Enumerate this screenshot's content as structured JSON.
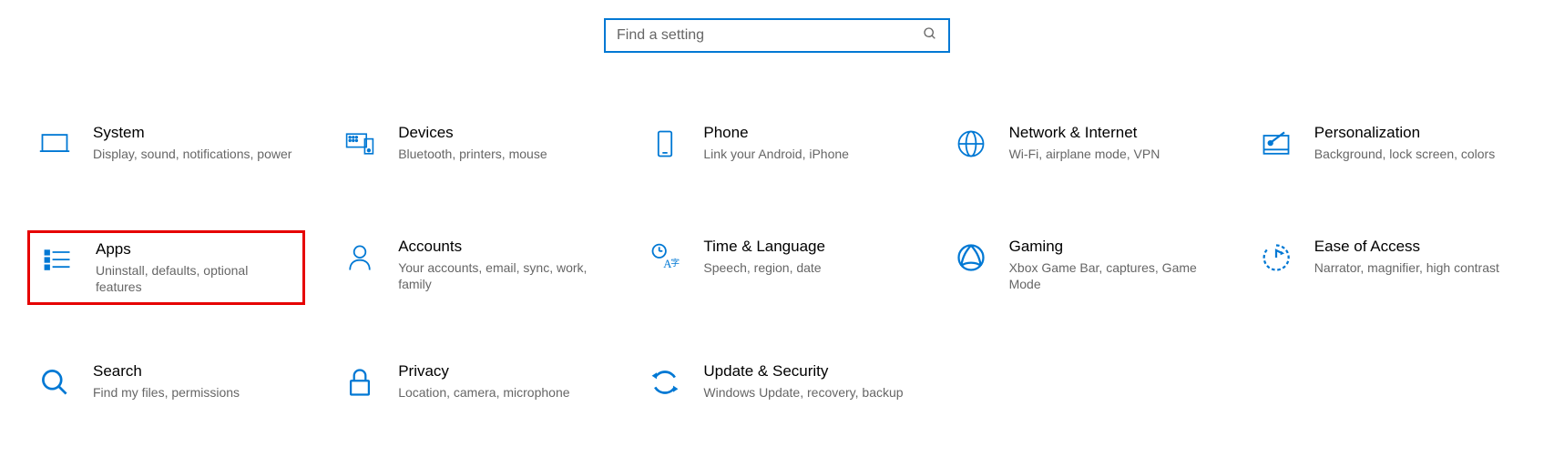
{
  "search": {
    "placeholder": "Find a setting"
  },
  "categories": [
    {
      "id": "system",
      "title": "System",
      "desc": "Display, sound, notifications, power",
      "highlighted": false
    },
    {
      "id": "devices",
      "title": "Devices",
      "desc": "Bluetooth, printers, mouse",
      "highlighted": false
    },
    {
      "id": "phone",
      "title": "Phone",
      "desc": "Link your Android, iPhone",
      "highlighted": false
    },
    {
      "id": "network",
      "title": "Network & Internet",
      "desc": "Wi-Fi, airplane mode, VPN",
      "highlighted": false
    },
    {
      "id": "personalization",
      "title": "Personalization",
      "desc": "Background, lock screen, colors",
      "highlighted": false
    },
    {
      "id": "apps",
      "title": "Apps",
      "desc": "Uninstall, defaults, optional features",
      "highlighted": true
    },
    {
      "id": "accounts",
      "title": "Accounts",
      "desc": "Your accounts, email, sync, work, family",
      "highlighted": false
    },
    {
      "id": "time",
      "title": "Time & Language",
      "desc": "Speech, region, date",
      "highlighted": false
    },
    {
      "id": "gaming",
      "title": "Gaming",
      "desc": "Xbox Game Bar, captures, Game Mode",
      "highlighted": false
    },
    {
      "id": "ease",
      "title": "Ease of Access",
      "desc": "Narrator, magnifier, high contrast",
      "highlighted": false
    },
    {
      "id": "search",
      "title": "Search",
      "desc": "Find my files, permissions",
      "highlighted": false
    },
    {
      "id": "privacy",
      "title": "Privacy",
      "desc": "Location, camera, microphone",
      "highlighted": false
    },
    {
      "id": "update",
      "title": "Update & Security",
      "desc": "Windows Update, recovery, backup",
      "highlighted": false
    }
  ],
  "colors": {
    "accent": "#0078d4",
    "highlight": "#e60000"
  }
}
